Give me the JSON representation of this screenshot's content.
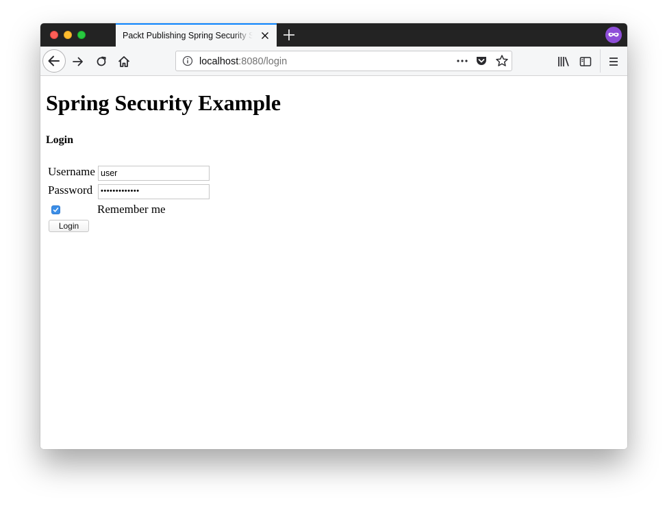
{
  "browser": {
    "tab_title": "Packt Publishing Spring Security Sa",
    "url_host": "localhost",
    "url_rest": ":8080/login"
  },
  "icons": {
    "back": "arrow-left-icon",
    "forward": "arrow-right-icon",
    "reload": "reload-icon",
    "home": "home-icon",
    "site_info": "info-icon",
    "page_actions": "more-dots-icon",
    "pocket": "pocket-icon",
    "bookmark": "star-icon",
    "library": "library-icon",
    "sidebar": "sidebar-icon",
    "menu": "hamburger-menu-icon",
    "private_mask": "private-browsing-mask-icon"
  },
  "colors": {
    "tab_accent": "#0a84ff",
    "private_mask": "#8e4ed8",
    "checkbox": "#3b8ee7"
  },
  "page": {
    "title": "Spring Security Example",
    "subtitle": "Login",
    "username_label": "Username",
    "username_value": "user",
    "password_label": "Password",
    "password_value": "•••••••••••••",
    "remember_label": "Remember me",
    "remember_checked": true,
    "login_button": "Login"
  }
}
